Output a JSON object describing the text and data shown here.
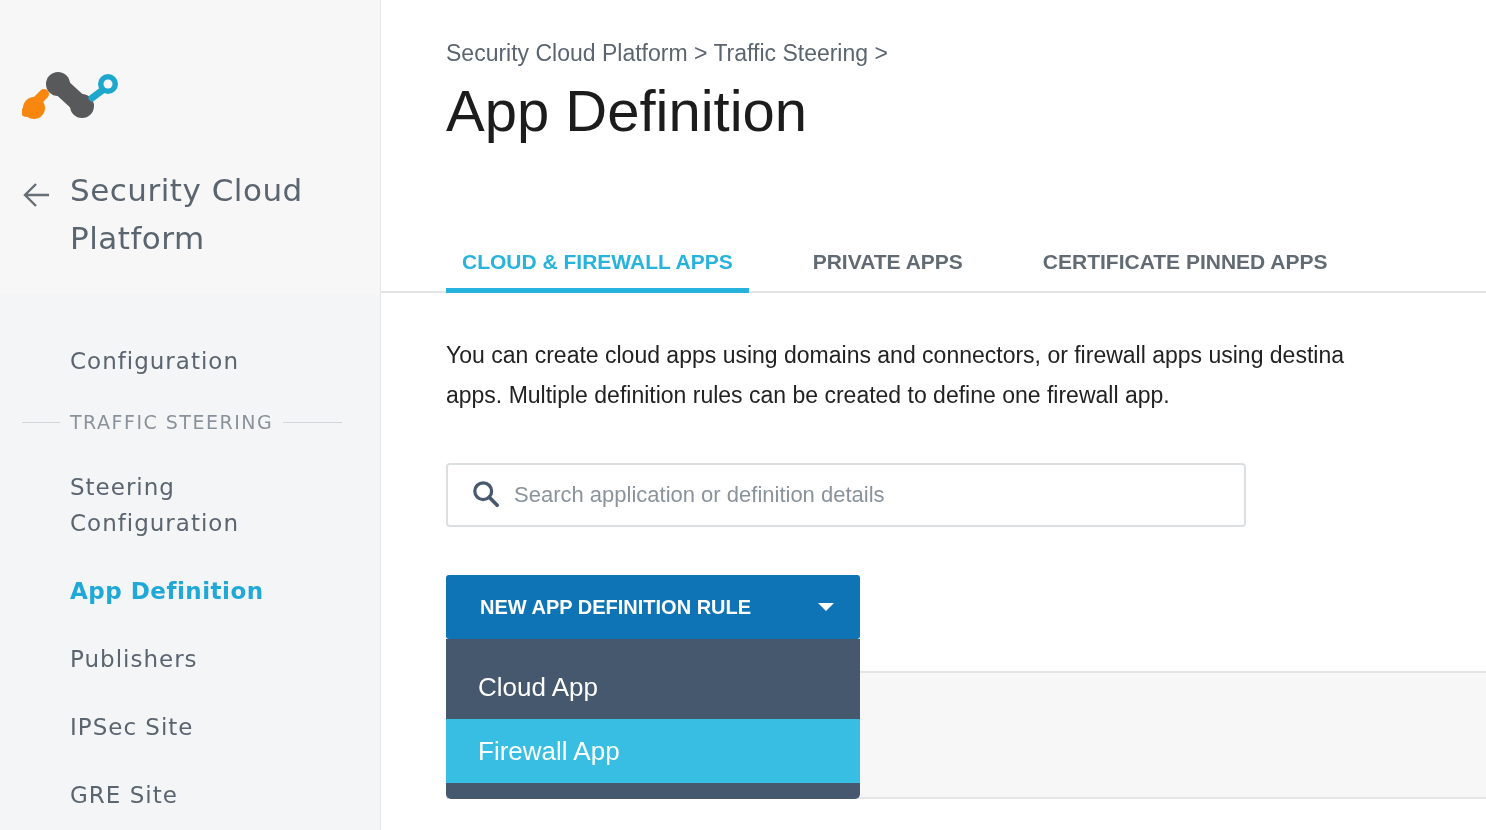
{
  "sidebar": {
    "back_label": "Security Cloud Platform",
    "items": [
      {
        "kind": "link",
        "label": "Configuration",
        "selected": false
      },
      {
        "kind": "section",
        "label": "TRAFFIC STEERING"
      },
      {
        "kind": "link",
        "label": "Steering Configuration",
        "selected": false
      },
      {
        "kind": "link",
        "label": "App Definition",
        "selected": true
      },
      {
        "kind": "link",
        "label": "Publishers",
        "selected": false
      },
      {
        "kind": "link",
        "label": "IPSec Site",
        "selected": false
      },
      {
        "kind": "link",
        "label": "GRE Site",
        "selected": false
      }
    ]
  },
  "breadcrumb": "Security Cloud Platform > Traffic Steering >",
  "page_title": "App Definition",
  "tabs": [
    {
      "label": "CLOUD & FIREWALL APPS",
      "selected": true
    },
    {
      "label": "PRIVATE APPS",
      "selected": false
    },
    {
      "label": "CERTIFICATE PINNED APPS",
      "selected": false
    }
  ],
  "description": [
    "You can create cloud apps using domains and connectors, or firewall apps using destina",
    "apps. Multiple definition rules can be created to define one firewall app."
  ],
  "search": {
    "placeholder": "Search application or definition details"
  },
  "new_rule_button": {
    "label": "NEW APP DEFINITION RULE"
  },
  "menu": [
    {
      "label": "Cloud App",
      "selected": false
    },
    {
      "label": "Firewall App",
      "selected": true
    }
  ]
}
